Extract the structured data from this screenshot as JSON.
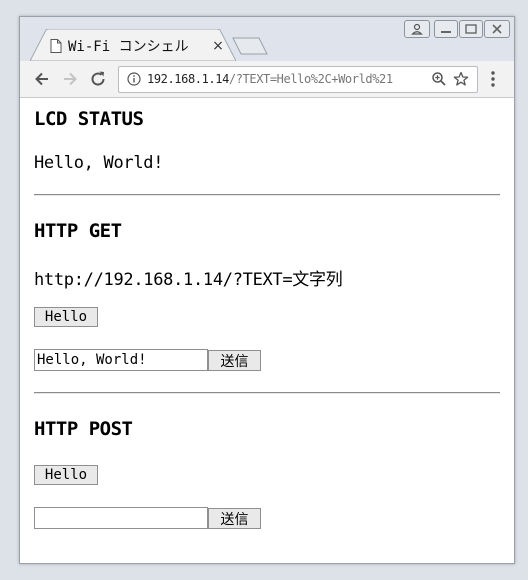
{
  "browser": {
    "tab_title": "Wi-Fi コンシェル",
    "tab_close": "×",
    "url_host": "192.168.1.14",
    "url_path": "/?TEXT=Hello%2C+World%21"
  },
  "lcd_status": {
    "heading": "LCD STATUS",
    "value": "Hello, World!"
  },
  "http_get": {
    "heading": "HTTP GET",
    "example": "http://192.168.1.14/?TEXT=文字列",
    "hello_button": "Hello",
    "text_value": "Hello, World!",
    "send_button": "送信"
  },
  "http_post": {
    "heading": "HTTP POST",
    "hello_button": "Hello",
    "text_value": "",
    "send_button": "送信"
  }
}
